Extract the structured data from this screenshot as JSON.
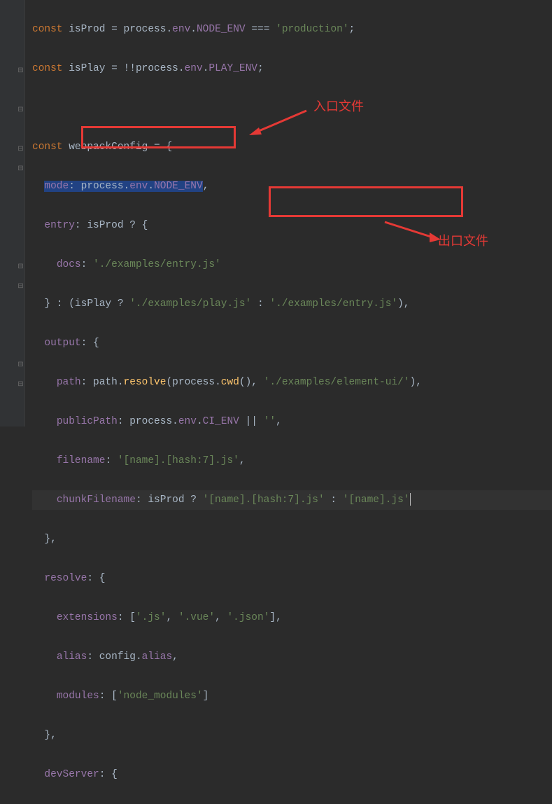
{
  "code": {
    "l1_kw1": "const",
    "l1_var": " isProd ",
    "l1_op": "= ",
    "l1_obj": "process",
    "l1_dot1": ".",
    "l1_env": "env",
    "l1_dot2": ".",
    "l1_node": "NODE_ENV ",
    "l1_eq": "=== ",
    "l1_str": "'production'",
    "l1_semi": ";",
    "l2_kw1": "const",
    "l2_var": " isPlay ",
    "l2_op": "= !!",
    "l2_obj": "process",
    "l2_dot1": ".",
    "l2_env": "env",
    "l2_dot2": ".",
    "l2_play": "PLAY_ENV",
    "l2_semi": ";",
    "l4_kw1": "const",
    "l4_var": " webpackConfig ",
    "l4_op": "= {",
    "l5_prop": "mode",
    "l5_colon": ": ",
    "l5_obj": "process",
    "l5_dot1": ".",
    "l5_env": "env",
    "l5_dot2": ".",
    "l5_node": "NODE_ENV",
    "l5_comma": ",",
    "l6_prop": "entry",
    "l6_rest": ": isProd ? {",
    "l7_prop": "docs",
    "l7_colon": ": ",
    "l7_str": "'./examples/entry.js'",
    "l8_close": "} : (isPlay ? ",
    "l8_str1": "'./examples/play.js'",
    "l8_mid": " : ",
    "l8_str2": "'./examples/entry.js'",
    "l8_end": "),",
    "l9_prop": "output",
    "l9_rest": ": {",
    "l10_prop": "path",
    "l10_colon": ": path.",
    "l10_fn": "resolve",
    "l10_p1": "(process.",
    "l10_fn2": "cwd",
    "l10_p2": "(), ",
    "l10_str": "'./examples/element-ui/'",
    "l10_end": "),",
    "l11_prop": "publicPath",
    "l11_colon": ": process.",
    "l11_env": "env",
    "l11_dot": ".",
    "l11_ci": "CI_ENV ",
    "l11_or": "|| ",
    "l11_str": "''",
    "l11_end": ",",
    "l12_prop": "filename",
    "l12_colon": ": ",
    "l12_str": "'[name].[hash:7].js'",
    "l12_end": ",",
    "l13_prop": "chunkFilename",
    "l13_colon": ": isProd ? ",
    "l13_str1": "'[name].[hash:7].js'",
    "l13_mid": " : ",
    "l13_str2": "'[name].js'",
    "l14_close": "},",
    "l15_prop": "resolve",
    "l15_rest": ": {",
    "l16_prop": "extensions",
    "l16_colon": ": [",
    "l16_s1": "'.js'",
    "l16_c1": ", ",
    "l16_s2": "'.vue'",
    "l16_c2": ", ",
    "l16_s3": "'.json'",
    "l16_end": "],",
    "l17_prop": "alias",
    "l17_rest": ": config.",
    "l17_alias": "alias",
    "l17_end": ",",
    "l18_prop": "modules",
    "l18_colon": ": [",
    "l18_str": "'node_modules'",
    "l18_end": "]",
    "l19_close": "},",
    "l20_prop": "devServer",
    "l20_rest": ": {"
  },
  "annotations": {
    "label1": "入口文件",
    "label2": "出口文件"
  }
}
